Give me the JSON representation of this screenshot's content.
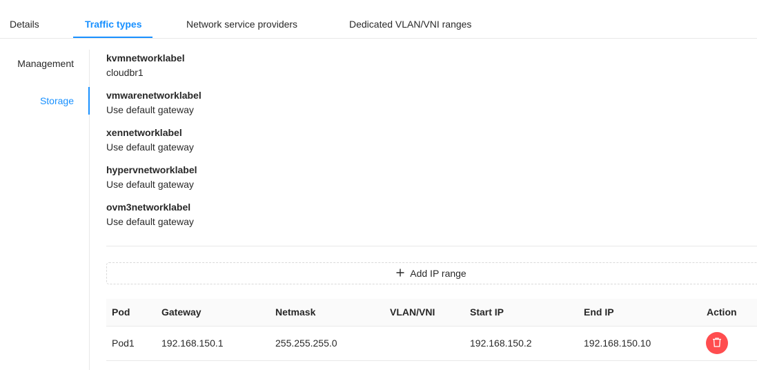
{
  "tabs": [
    {
      "label": "Details"
    },
    {
      "label": "Traffic types"
    },
    {
      "label": "Network service providers"
    },
    {
      "label": "Dedicated VLAN/VNI ranges"
    }
  ],
  "active_tab": "Traffic types",
  "side_nav": [
    {
      "label": "Management"
    },
    {
      "label": "Storage"
    }
  ],
  "active_side": "Storage",
  "labels": [
    {
      "title": "kvmnetworklabel",
      "value": "cloudbr1"
    },
    {
      "title": "vmwarenetworklabel",
      "value": "Use default gateway"
    },
    {
      "title": "xennetworklabel",
      "value": "Use default gateway"
    },
    {
      "title": "hypervnetworklabel",
      "value": "Use default gateway"
    },
    {
      "title": "ovm3networklabel",
      "value": "Use default gateway"
    }
  ],
  "add_ip_range": {
    "label": "Add IP range",
    "icon": "plus-icon"
  },
  "table": {
    "columns": [
      "Pod",
      "Gateway",
      "Netmask",
      "VLAN/VNI",
      "Start IP",
      "End IP",
      "Action"
    ],
    "rows": [
      {
        "pod": "Pod1",
        "gateway": "192.168.150.1",
        "netmask": "255.255.255.0",
        "vlan": "",
        "start_ip": "192.168.150.2",
        "end_ip": "192.168.150.10",
        "action_icon": "delete-icon"
      }
    ]
  },
  "colors": {
    "accent": "#1890ff",
    "danger": "#ff4d4f"
  }
}
